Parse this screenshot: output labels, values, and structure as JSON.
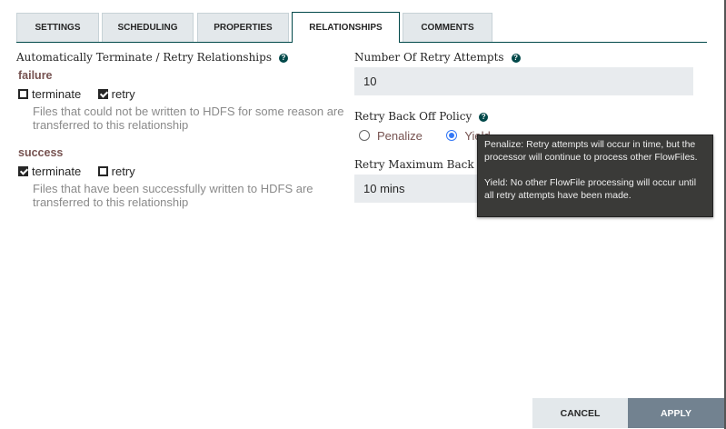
{
  "tabs": [
    "SETTINGS",
    "SCHEDULING",
    "PROPERTIES",
    "RELATIONSHIPS",
    "COMMENTS"
  ],
  "left": {
    "title": "Automatically Terminate / Retry Relationships",
    "relationships": [
      {
        "name": "failure",
        "terminate_label": "terminate",
        "retry_label": "retry",
        "terminate": false,
        "retry": true,
        "description": "Files that could not be written to HDFS for some reason are transferred to this relationship"
      },
      {
        "name": "success",
        "terminate_label": "terminate",
        "retry_label": "retry",
        "terminate": true,
        "retry": false,
        "description": "Files that have been successfully written to HDFS are transferred to this relationship"
      }
    ]
  },
  "right": {
    "retry_attempts_label": "Number Of Retry Attempts",
    "retry_attempts_value": "10",
    "backoff_policy_label": "Retry Back Off Policy",
    "penalize_label": "Penalize",
    "yield_label": "Yield",
    "selected_policy": "Yield",
    "max_backoff_label": "Retry Maximum Back Off Period",
    "max_backoff_value": "10 mins"
  },
  "tooltip": {
    "penalize": "Penalize: Retry attempts will occur in time, but the processor will continue to process other FlowFiles.",
    "yield": "Yield: No other FlowFile processing will occur until all retry attempts have been made."
  },
  "buttons": {
    "cancel": "CANCEL",
    "apply": "APPLY"
  }
}
